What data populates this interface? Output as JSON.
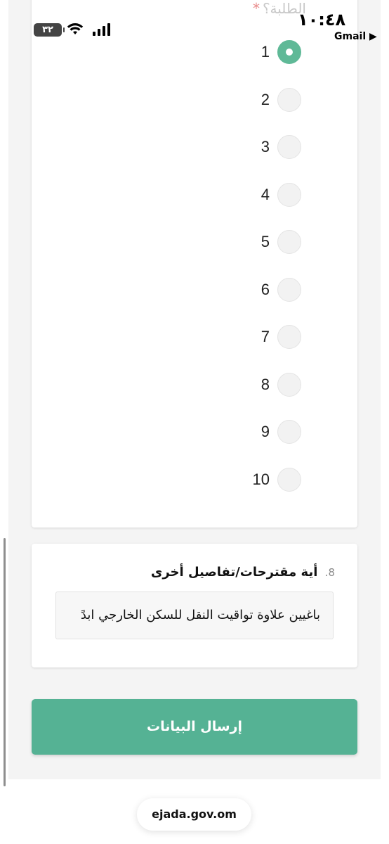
{
  "status": {
    "time": "١٠:٤٨",
    "back_app": "Gmail",
    "battery": "٣٢"
  },
  "question7": {
    "partial_title": "الطلبة؟",
    "required_mark": "*",
    "options": [
      "1",
      "2",
      "3",
      "4",
      "5",
      "6",
      "7",
      "8",
      "9",
      "10"
    ],
    "selected": "1"
  },
  "question8": {
    "number": "8.",
    "title": "أية مقترحات/تفاصيل أخرى",
    "value": "باغيين علاوة تواقيت النقل  للسكن الخارجي ابدً"
  },
  "submit_label": "إرسال البيانات",
  "url": "ejada.gov.om",
  "colors": {
    "accent": "#55b294"
  }
}
